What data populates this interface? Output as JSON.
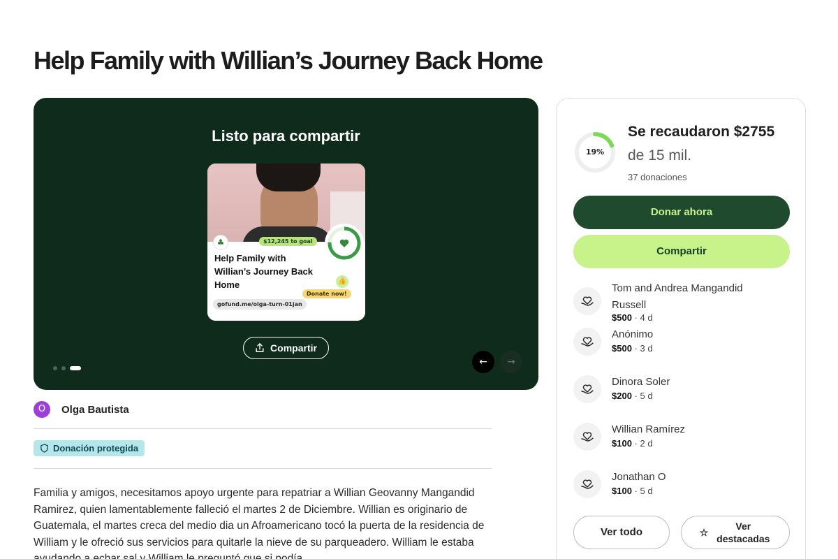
{
  "page": {
    "title": "Help Family with Willian’s Journey Back Home"
  },
  "hero": {
    "heading": "Listo para compartir",
    "card": {
      "goal_badge": "$12,245 to goal",
      "title": "Help Family with Willian’s Journey Back Home",
      "donate_badge": "Donate now!",
      "url": "gofund.me/olga-turn-01jan"
    },
    "share_label": "Compartir",
    "slides": 3,
    "active_slide": 3
  },
  "organizer": {
    "initial": "O",
    "name": "Olga Bautista"
  },
  "badge": {
    "label": "Donación protegida"
  },
  "story": "Familia y amigos, necesitamos apoyo urgente para repatriar a Willian Geovanny Mangandid Ramirez, quien lamentablemente falleció el martes 2 de Diciembre. Willian es originario de Guatemala, el martes creca del medio dia un Afroamericano tocó la puerta de la residencia de William y le ofreció sus servicios para quitarle la nieve de su parqueadero. William le estaba ayudando a echar sal y William le preguntó que si podía",
  "sidebar": {
    "progress_percent": 19,
    "progress_label": "19%",
    "raised": "Se recaudaron $2755",
    "goal": "de 15 mil.",
    "donations_count": "37 donaciones",
    "donate_label": "Donar ahora",
    "share_label": "Compartir",
    "donors": [
      {
        "name": "Tom and Andrea Mangandid Russell",
        "amount": "$500",
        "time": " · 4 d"
      },
      {
        "name": "Anónimo",
        "amount": "$500",
        "time": " · 3 d"
      },
      {
        "name": "Dinora Soler",
        "amount": "$200",
        "time": " · 5 d"
      },
      {
        "name": "Willian Ramírez",
        "amount": "$100",
        "time": " · 2 d"
      },
      {
        "name": "Jonathan O",
        "amount": "$100",
        "time": " · 5 d"
      }
    ],
    "see_all_label": "Ver todo",
    "featured_label": "Ver destacadas"
  },
  "colors": {
    "hero_bg": "#0f2b1b",
    "primary": "#1f4a2e",
    "accent": "#c8f38a",
    "progress": "#7ed957"
  }
}
